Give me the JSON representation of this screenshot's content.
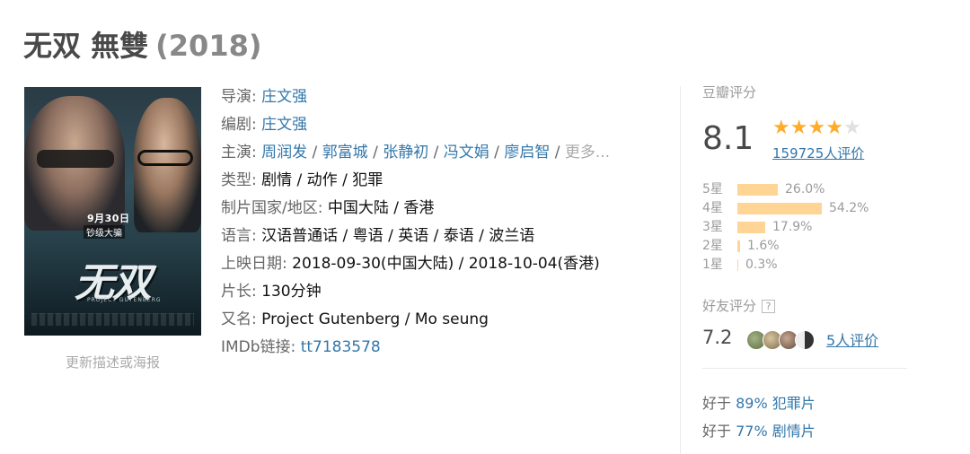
{
  "title": {
    "name": "无双 無雙",
    "year": "(2018)"
  },
  "poster": {
    "date": "9月30日",
    "tag": "钞级大骗",
    "logo": "无双",
    "sub": "PROJECT GUTENBERG",
    "caption": "更新描述或海报"
  },
  "info": {
    "director_label": "导演:",
    "director": "庄文强",
    "writer_label": "编剧:",
    "writer": "庄文强",
    "cast_label": "主演:",
    "cast": [
      "周润发",
      "郭富城",
      "张静初",
      "冯文娟",
      "廖启智"
    ],
    "cast_more": "更多...",
    "genre_label": "类型:",
    "genre": "剧情 / 动作 / 犯罪",
    "country_label": "制片国家/地区:",
    "country": "中国大陆 / 香港",
    "language_label": "语言:",
    "language": "汉语普通话 / 粤语 / 英语 / 泰语 / 波兰语",
    "release_label": "上映日期:",
    "release": "2018-09-30(中国大陆) / 2018-10-04(香港)",
    "runtime_label": "片长:",
    "runtime": "130分钟",
    "aka_label": "又名:",
    "aka": "Project Gutenberg / Mo seung",
    "imdb_label": "IMDb链接:",
    "imdb": "tt7183578"
  },
  "rating": {
    "title": "豆瓣评分",
    "score": "8.1",
    "stars": 4,
    "votes": "159725人评价",
    "distribution": [
      {
        "label": "5星",
        "pct": "26.0%",
        "value": 26.0
      },
      {
        "label": "4星",
        "pct": "54.2%",
        "value": 54.2
      },
      {
        "label": "3星",
        "pct": "17.9%",
        "value": 17.9
      },
      {
        "label": "2星",
        "pct": "1.6%",
        "value": 1.6
      },
      {
        "label": "1星",
        "pct": "0.3%",
        "value": 0.3
      }
    ],
    "friends_title": "好友评分",
    "friends_help": "?",
    "friends_score": "7.2",
    "friends_votes": "5人评价",
    "better_than": [
      {
        "prefix": "好于",
        "pct": "89%",
        "genre": "犯罪片"
      },
      {
        "prefix": "好于",
        "pct": "77%",
        "genre": "剧情片"
      }
    ]
  },
  "colors": {
    "link": "#3377aa",
    "star": "#ffac2d",
    "bar": "#ffd596"
  }
}
